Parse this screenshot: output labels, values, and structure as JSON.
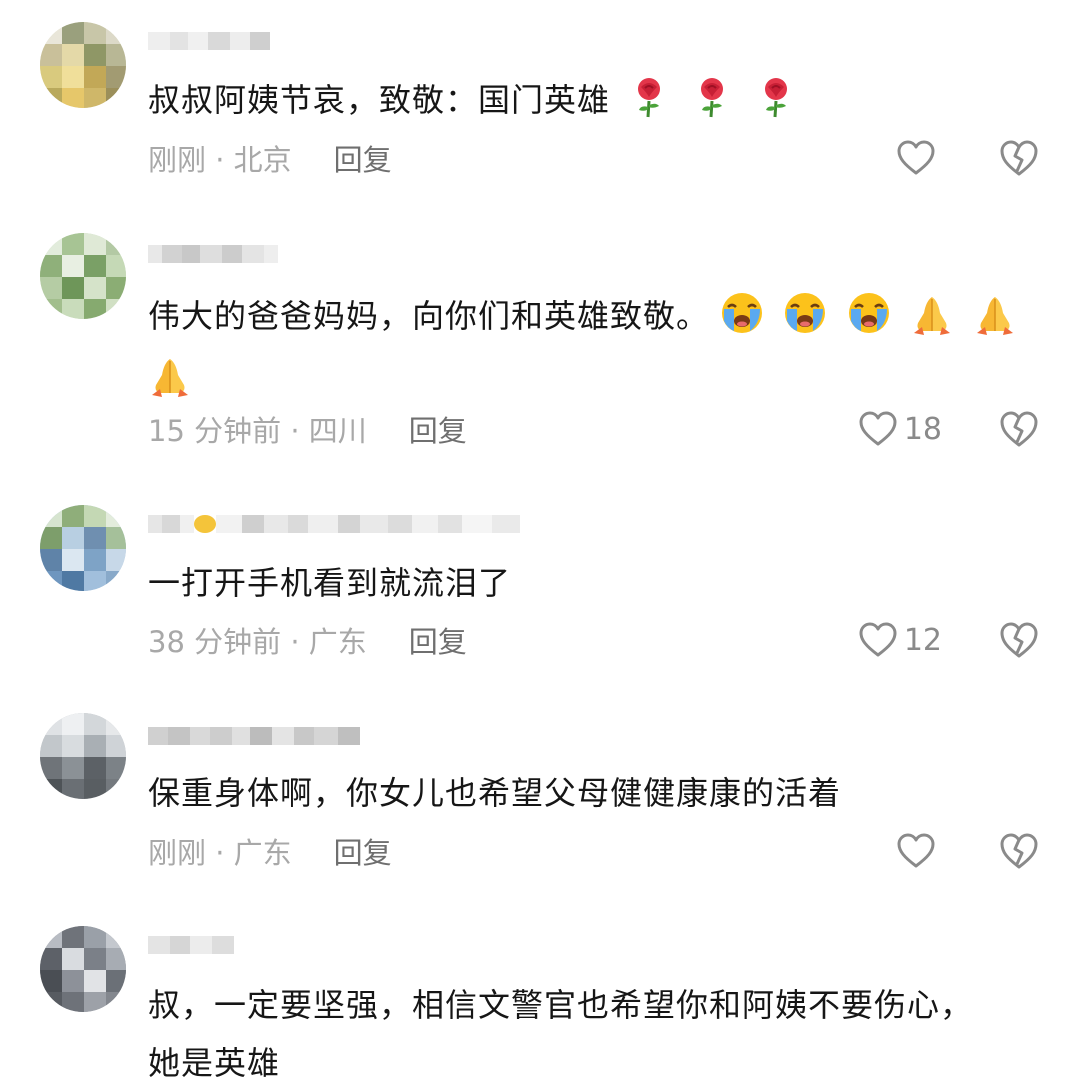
{
  "comments": [
    {
      "id": "c1",
      "text": "叔叔阿姨节哀，致敬：国门英雄",
      "emoji": [
        "rose",
        "rose",
        "rose"
      ],
      "time": "刚刚 · 北京",
      "reply": "回复",
      "likes": ""
    },
    {
      "id": "c2",
      "text": "伟大的爸爸妈妈，向你们和英雄致敬。",
      "emoji": [
        "crying-face",
        "crying-face",
        "crying-face",
        "folded-hands",
        "folded-hands",
        "folded-hands"
      ],
      "time": "15 分钟前 · 四川",
      "reply": "回复",
      "likes": "18"
    },
    {
      "id": "c3",
      "text": "一打开手机看到就流泪了",
      "emoji": [],
      "time": "38 分钟前 · 广东",
      "reply": "回复",
      "likes": "12"
    },
    {
      "id": "c4",
      "text": "保重身体啊，你女儿也希望父母健健康康的活着",
      "emoji": [],
      "time": "刚刚 · 广东",
      "reply": "回复",
      "likes": ""
    },
    {
      "id": "c5",
      "text": "叔，一定要坚强，相信文警官也希望你和阿姨不要伤心，她是英雄",
      "emoji": [],
      "time": "",
      "reply": "",
      "likes": ""
    }
  ],
  "icons": {
    "like": "heart-outline-icon",
    "dislike": "broken-heart-icon"
  },
  "colors": {
    "text": "#161616",
    "meta": "#a8a8a8",
    "reply": "#6f6f6f",
    "icon": "#8a8a8a"
  }
}
